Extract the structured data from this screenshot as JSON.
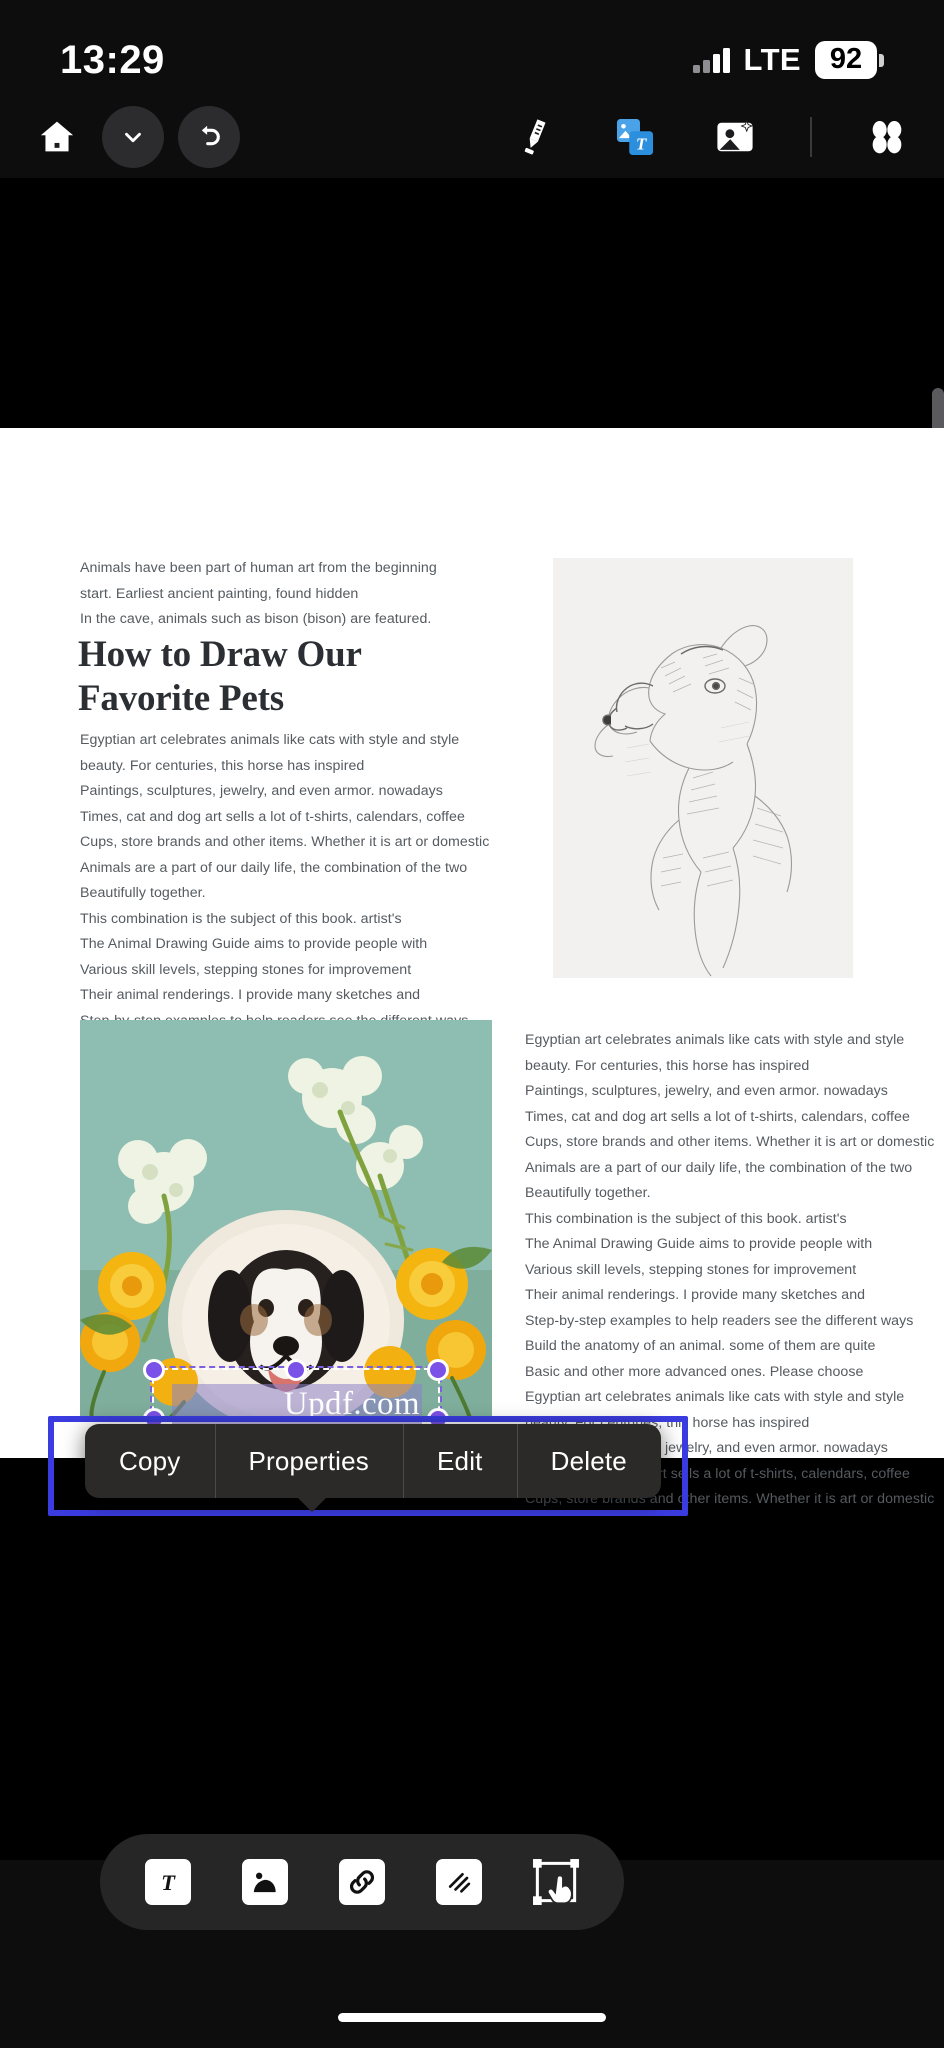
{
  "status_bar": {
    "time": "13:29",
    "network": "LTE",
    "battery_percent": "92",
    "signal_icon": "cellular-signal-icon",
    "battery_icon": "battery-icon"
  },
  "top_toolbar": {
    "home_label": "home-icon",
    "chevron_label": "chevron-down-icon",
    "undo_label": "undo-icon",
    "highlighter_label": "highlighter-icon",
    "text_image_label": "edit-text-image-icon",
    "ai_image_label": "ai-image-icon",
    "grid_label": "grid-apps-icon"
  },
  "document": {
    "intro_lines": [
      "Animals have been part of human art from the beginning",
      "start. Earliest ancient painting, found hidden",
      "In the cave, animals such as bison (bison) are featured."
    ],
    "heading_line_1": "How to Draw Our",
    "heading_line_2": "Favorite Pets",
    "body_lines": [
      "Egyptian art celebrates animals like cats with style and style",
      "beauty. For centuries, this horse has inspired",
      "Paintings, sculptures, jewelry, and even armor. nowadays",
      "Times, cat and dog art sells a lot of t-shirts, calendars, coffee",
      "Cups, store brands and other items. Whether it is art or domestic",
      "Animals are a part of our daily life, the combination of the two",
      "Beautifully together.",
      "This combination is the subject of this book. artist's",
      "The Animal Drawing Guide aims to provide people with",
      "Various skill levels, stepping stones for improvement",
      "Their animal renderings. I provide many sketches and",
      "Step-by-step examples to help readers see the different ways",
      "Build the anatomy of an animal. some of them are quite",
      "Basic and other more advanced ones. Please choose"
    ],
    "right_column_lines": [
      "Egyptian art celebrates animals like cats with style and style",
      "beauty. For centuries, this horse has inspired",
      "Paintings, sculptures, jewelry, and even armor. nowadays",
      "Times, cat and dog art sells a lot of t-shirts, calendars, coffee",
      "Cups, store brands and other items. Whether it is art or domestic",
      "Animals are a part of our daily life, the combination of the two",
      "Beautifully together.",
      "This combination is the subject of this book. artist's",
      "The Animal Drawing Guide aims to provide people with",
      "Various skill levels, stepping stones for improvement",
      "Their animal renderings. I provide many sketches and",
      "Step-by-step examples to help readers see the different ways",
      "Build the anatomy of an animal. some of them are quite",
      "Basic and other more advanced ones. Please choose",
      "Egyptian art celebrates animals like cats with style and style",
      "beauty. For centuries, this horse has inspired",
      "Paintings, sculptures, jewelry, and even armor. nowadays",
      "Times, cat and dog art sells a lot of t-shirts, calendars, coffee",
      "Cups, store brands and other items. Whether it is art or domestic"
    ],
    "sketch_image_alt": "pencil-sketch-dog-image",
    "photo_image_alt": "dog-with-flowers-photo"
  },
  "selection": {
    "watermark_text": "Updf.com",
    "handle_color": "#7b52e8",
    "highlight_color": "#3b3ce0"
  },
  "context_menu": {
    "items": [
      {
        "label": "Copy"
      },
      {
        "label": "Properties"
      },
      {
        "label": "Edit"
      },
      {
        "label": "Delete"
      }
    ]
  },
  "bottom_toolbar": {
    "items": [
      {
        "icon": "text-tool-icon"
      },
      {
        "icon": "image-tool-icon"
      },
      {
        "icon": "link-tool-icon"
      },
      {
        "icon": "stamp-tool-icon"
      },
      {
        "icon": "select-object-tool-icon"
      }
    ]
  }
}
